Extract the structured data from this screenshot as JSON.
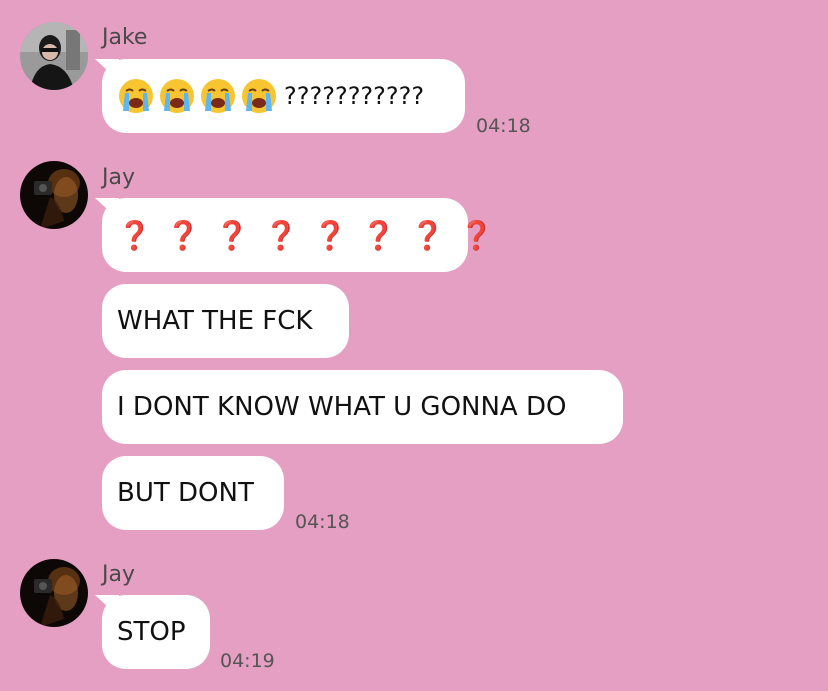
{
  "groups": [
    {
      "sender": "Jake",
      "avatar": "avatar-jake",
      "messages": [
        {
          "emoji": "loudly-crying-face",
          "emoji_count": 4,
          "text": "???????????"
        }
      ],
      "time": "04:18"
    },
    {
      "sender": "Jay",
      "avatar": "avatar-jay",
      "messages": [
        {
          "text": "❓❓❓❓❓❓❓❓",
          "emoji": "red-question-mark"
        },
        {
          "text": "WHAT THE FCK"
        },
        {
          "text": "I DONT KNOW WHAT U GONNA DO"
        },
        {
          "text": "BUT DONT"
        }
      ],
      "time": "04:18"
    },
    {
      "sender": "Jay",
      "avatar": "avatar-jay",
      "messages": [
        {
          "text": "STOP"
        }
      ],
      "time": "04:19"
    }
  ],
  "colors": {
    "background": "#e59fc2",
    "bubble": "#ffffff",
    "question_red": "#c62b2b"
  }
}
